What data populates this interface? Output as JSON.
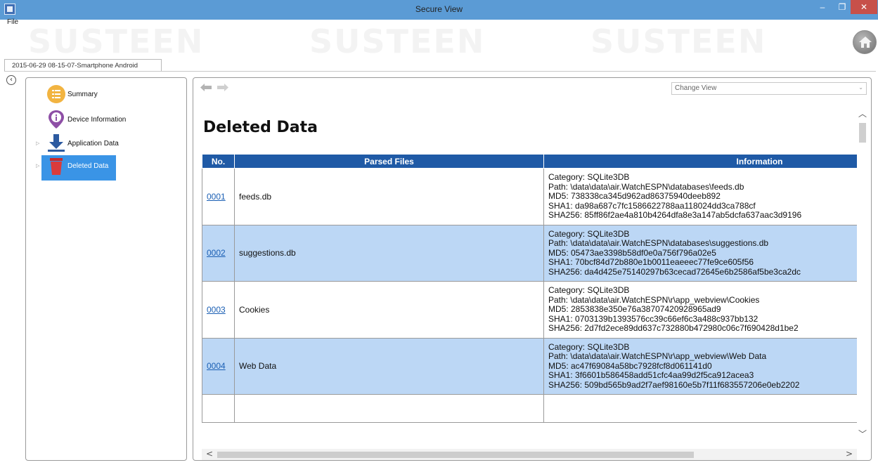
{
  "window": {
    "title": "Secure View",
    "minimize_label": "–",
    "maximize_label": "❐",
    "close_label": "✕"
  },
  "menu": {
    "file": "File"
  },
  "banner": {
    "watermark": "SUSTEEN"
  },
  "session_tab": {
    "label": "2015-06-29 08-15-07-Smartphone Android"
  },
  "sidebar": {
    "collapse_glyph": "‹",
    "items": [
      {
        "label": "Summary",
        "icon": "summary-icon"
      },
      {
        "label": "Device Information",
        "icon": "info-pin-icon"
      },
      {
        "label": "Application Data",
        "icon": "download-icon"
      },
      {
        "label": "Deleted Data",
        "icon": "trash-icon",
        "selected": true
      }
    ]
  },
  "main": {
    "change_view_placeholder": "Change View",
    "heading": "Deleted Data",
    "table": {
      "headers": [
        "No.",
        "Parsed Files",
        "Information"
      ],
      "rows": [
        {
          "no": "0001",
          "file": "feeds.db",
          "info": [
            "Category: SQLite3DB",
            "Path: \\data\\data\\air.WatchESPN\\databases\\feeds.db",
            "MD5: 738338ca345d962ad86375940deeb892",
            "SHA1: da98a687c7fc1586622788aa118024dd3ca788cf",
            "SHA256: 85ff86f2ae4a810b4264dfa8e3a147ab5dcfa637aac3d9196"
          ]
        },
        {
          "no": "0002",
          "file": "suggestions.db",
          "info": [
            "Category: SQLite3DB",
            "Path: \\data\\data\\air.WatchESPN\\databases\\suggestions.db",
            "MD5: 05473ae3398b58df0e0a756f796a02e5",
            "SHA1: 70bcf84d72b880e1b0011eaeeec77fe9ce605f56",
            "SHA256: da4d425e75140297b63cecad72645e6b2586af5be3ca2dc"
          ]
        },
        {
          "no": "0003",
          "file": "Cookies",
          "info": [
            "Category: SQLite3DB",
            "Path: \\data\\data\\air.WatchESPN\\r\\app_webview\\Cookies",
            "MD5: 2853838e350e76a38707420928965ad9",
            "SHA1: 0703139b1393576cc39c66ef6c3a488c937bb132",
            "SHA256: 2d7fd2ece89dd637c732880b472980c06c7f690428d1be2"
          ]
        },
        {
          "no": "0004",
          "file": "Web Data",
          "info": [
            "Category: SQLite3DB",
            "Path: \\data\\data\\air.WatchESPN\\r\\app_webview\\Web Data",
            "MD5: ac47f69084a58bc7928fcf8d061141d0",
            "SHA1: 3f6601b586458add51cfc4aa99d2f5ca912acea3",
            "SHA256: 509bd565b9ad2f7aef98160e5b7f11f683557206e0eb2202"
          ]
        }
      ]
    }
  },
  "colors": {
    "titlebar": "#5b9bd5",
    "table_header": "#1f5aa6",
    "row_alt": "#bcd7f5",
    "selected_item": "#3a94e6",
    "link": "#1a5fb4"
  }
}
